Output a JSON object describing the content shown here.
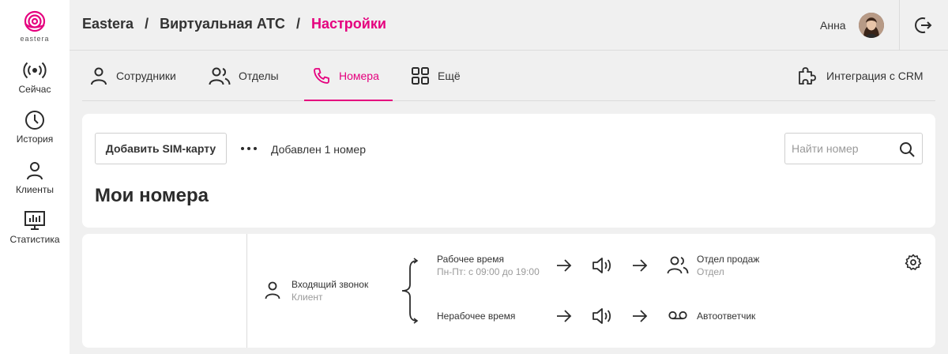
{
  "sidebar": {
    "logo_text": "eastera",
    "items": [
      {
        "label": "Сейчас",
        "icon": "broadcast-icon"
      },
      {
        "label": "История",
        "icon": "clock-icon"
      },
      {
        "label": "Клиенты",
        "icon": "person-icon"
      },
      {
        "label": "Статистика",
        "icon": "chart-icon"
      }
    ]
  },
  "header": {
    "breadcrumbs": [
      "Eastera",
      "Виртуальная АТС",
      "Настройки"
    ],
    "separator": "/",
    "user_name": "Анна"
  },
  "tabs": {
    "items": [
      {
        "label": "Сотрудники",
        "icon": "person-icon"
      },
      {
        "label": "Отделы",
        "icon": "group-icon"
      },
      {
        "label": "Номера",
        "icon": "phone-icon",
        "active": true
      },
      {
        "label": "Ещё",
        "icon": "grid-icon"
      }
    ],
    "crm": {
      "label": "Интеграция с CRM",
      "icon": "puzzle-icon"
    }
  },
  "numbers_panel": {
    "add_button": "Добавить SIM-карту",
    "added_text": "Добавлен 1 номер",
    "search_placeholder": "Найти номер",
    "title": "Мои номера"
  },
  "routing": {
    "incoming": {
      "title": "Входящий звонок",
      "subtitle": "Клиент"
    },
    "work": {
      "title": "Рабочее время",
      "subtitle": "Пн-Пт: с 09:00 до 19:00"
    },
    "nonwork": {
      "title": "Нерабочее время"
    },
    "work_target": {
      "title": "Отдел продаж",
      "subtitle": "Отдел"
    },
    "nonwork_target": {
      "title": "Автоответчик"
    }
  },
  "colors": {
    "accent": "#e5007e",
    "background": "#f0f0f0"
  }
}
